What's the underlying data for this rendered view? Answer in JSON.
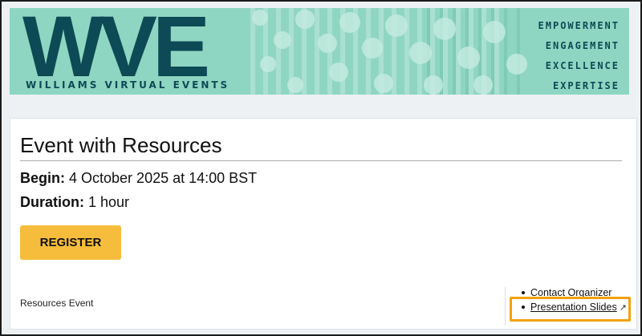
{
  "banner": {
    "logo_text": "WVE",
    "logo_subtitle": "WILLIAMS VIRTUAL EVENTS",
    "taglines": [
      "EMPOWERMENT",
      "ENGAGEMENT",
      "EXCELLENCE",
      "EXPERTISE"
    ],
    "colors": {
      "background": "#8fd6c2",
      "text": "#0d4a55"
    }
  },
  "event": {
    "title": "Event with Resources",
    "begin_label": "Begin:",
    "begin_value": "4 October 2025 at 14:00 BST",
    "duration_label": "Duration:",
    "duration_value": "1 hour",
    "register_label": "REGISTER",
    "description": "Resources Event"
  },
  "links": [
    {
      "label": "Contact Organizer"
    },
    {
      "label": "Presentation Slides",
      "icon": "external-link-icon"
    }
  ],
  "accent": {
    "register_button": "#f6bd3d",
    "highlight": "#f2a20e"
  }
}
